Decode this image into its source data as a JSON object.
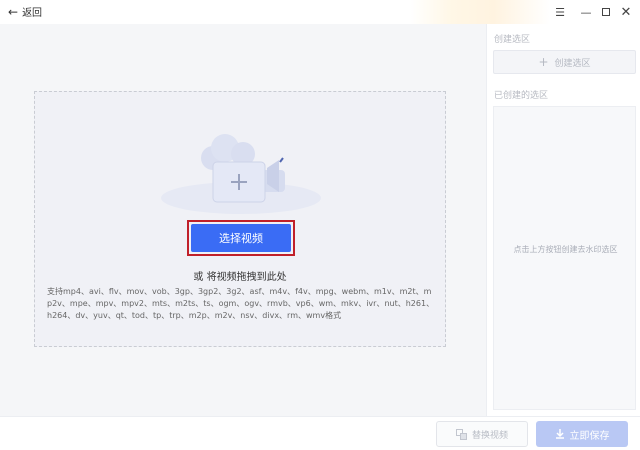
{
  "titlebar": {
    "back_icon": "back-arrow-icon",
    "back_label": "返回",
    "controls": {
      "menu_icon": "menu-icon",
      "minimize_icon": "minimize-icon",
      "maximize_icon": "maximize-icon",
      "close_icon": "close-icon"
    }
  },
  "dropzone": {
    "select_button_label": "选择视频",
    "drag_hint": "或 将视频拖拽到此处",
    "formats_text": "支持mp4、avi、flv、mov、vob、3gp、3gp2、3g2、asf、m4v、f4v、mpg、webm、m1v、m2t、mp2v、mpe、mpv、mpv2、mts、m2ts、ts、ogm、ogv、rmvb、vp6、wm、mkv、ivr、nut、h261、h264、dv、yuv、qt、tod、tp、trp、m2p、m2v、nsv、divx、rm、wmv格式",
    "illustration_icon": "video-add-icon"
  },
  "side": {
    "create_title": "创建选区",
    "create_button_label": "创建选区",
    "create_icon": "plus-icon",
    "created_title": "已创建的选区",
    "empty_hint": "点击上方按钮创建去水印选区"
  },
  "footer": {
    "replace_label": "替换视频",
    "replace_icon": "replace-icon",
    "save_label": "立即保存",
    "save_icon": "download-icon"
  },
  "colors": {
    "primary": "#3a6cf5",
    "highlight_border": "#c0202a",
    "save_disabled": "#b9c8f4"
  }
}
